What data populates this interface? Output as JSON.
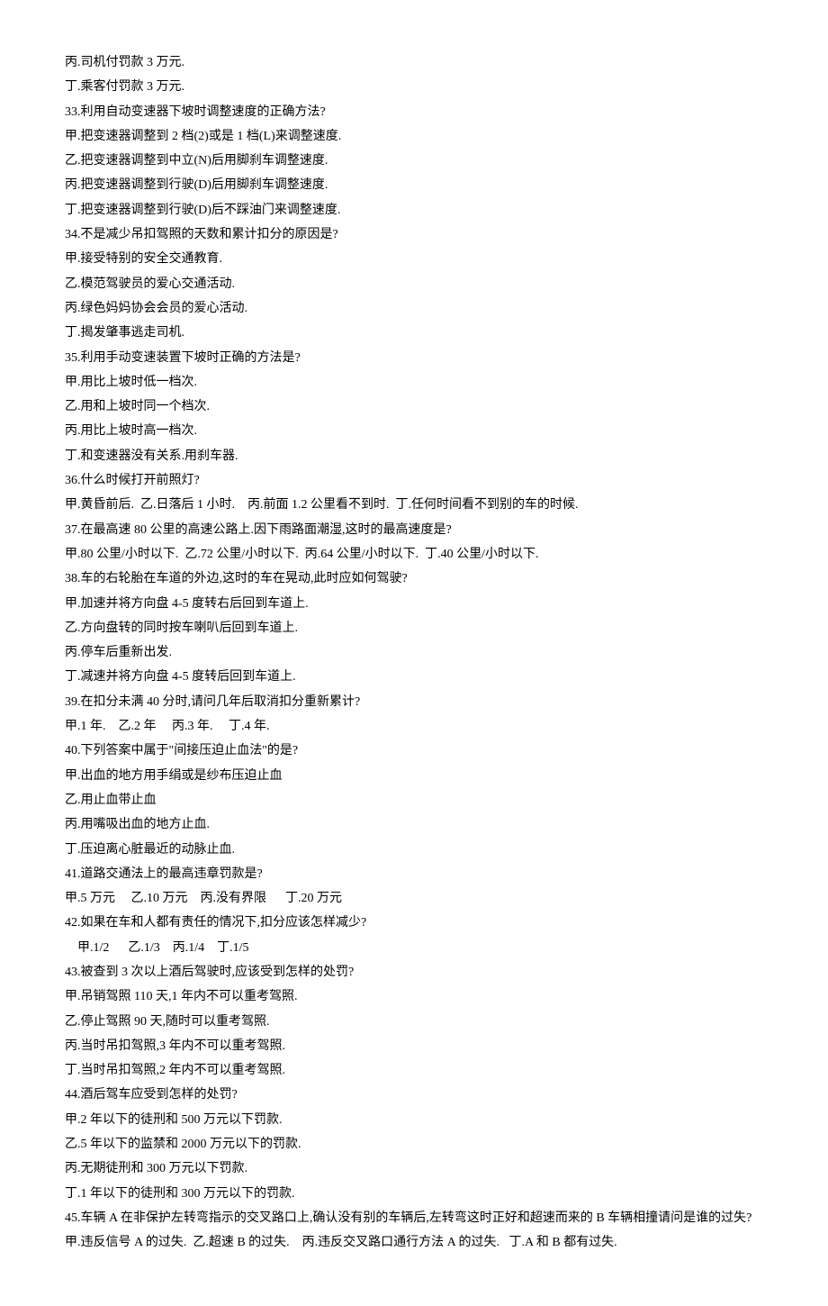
{
  "lines": [
    {
      "text": "丙.司机付罚款 3 万元.",
      "indent": false
    },
    {
      "text": "丁.乘客付罚款 3 万元.",
      "indent": false
    },
    {
      "text": "33.利用自动变速器下坡时调整速度的正确方法?",
      "indent": false
    },
    {
      "text": "甲.把变速器调整到 2 档(2)或是 1 档(L)来调整速度.",
      "indent": false
    },
    {
      "text": "乙.把变速器调整到中立(N)后用脚刹车调整速度.",
      "indent": false
    },
    {
      "text": "丙.把变速器调整到行驶(D)后用脚刹车调整速度.",
      "indent": false
    },
    {
      "text": "丁.把变速器调整到行驶(D)后不踩油门来调整速度.",
      "indent": false
    },
    {
      "text": "34.不是减少吊扣驾照的天数和累计扣分的原因是?",
      "indent": false
    },
    {
      "text": "甲.接受特别的安全交通教育.",
      "indent": false
    },
    {
      "text": "乙.模范驾驶员的爱心交通活动.",
      "indent": false
    },
    {
      "text": "丙.绿色妈妈协会会员的爱心活动.",
      "indent": false
    },
    {
      "text": "丁.揭发肇事逃走司机.",
      "indent": false
    },
    {
      "text": "35.利用手动变速装置下坡时正确的方法是?",
      "indent": false
    },
    {
      "text": "甲.用比上坡时低一档次.",
      "indent": false
    },
    {
      "text": "乙.用和上坡时同一个档次.",
      "indent": false
    },
    {
      "text": "丙.用比上坡时高一档次.",
      "indent": false
    },
    {
      "text": "丁.和变速器没有关系.用刹车器.",
      "indent": false
    },
    {
      "text": "36.什么时候打开前照灯?",
      "indent": false
    },
    {
      "text": "甲.黄昏前后.  乙.日落后 1 小时.    丙.前面 1.2 公里看不到时.  丁.任何时间看不到别的车的时候.",
      "indent": false
    },
    {
      "text": "37.在最高速 80 公里的高速公路上.因下雨路面潮湿,这时的最高速度是?",
      "indent": false
    },
    {
      "text": "甲.80 公里/小时以下.  乙.72 公里/小时以下.  丙.64 公里/小时以下.  丁.40 公里/小时以下.",
      "indent": false
    },
    {
      "text": "38.车的右轮胎在车道的外边,这时的车在晃动,此时应如何驾驶?",
      "indent": false
    },
    {
      "text": "甲.加速并将方向盘 4-5 度转右后回到车道上.",
      "indent": false
    },
    {
      "text": "乙.方向盘转的同时按车喇叭后回到车道上.",
      "indent": false
    },
    {
      "text": "丙.停车后重新出发.",
      "indent": false
    },
    {
      "text": "丁.减速并将方向盘 4-5 度转后回到车道上.",
      "indent": false
    },
    {
      "text": "39.在扣分未满 40 分时,请问几年后取消扣分重新累计?",
      "indent": false
    },
    {
      "text": "甲.1 年.    乙.2 年     丙.3 年.     丁.4 年.",
      "indent": false
    },
    {
      "text": "40.下列答案中属于\"间接压迫止血法\"的是?",
      "indent": false
    },
    {
      "text": "甲.出血的地方用手绢或是纱布压迫止血",
      "indent": false
    },
    {
      "text": "乙.用止血带止血",
      "indent": false
    },
    {
      "text": "丙.用嘴吸出血的地方止血.",
      "indent": false
    },
    {
      "text": "丁.压迫离心脏最近的动脉止血.",
      "indent": false
    },
    {
      "text": "41.道路交通法上的最高违章罚款是?",
      "indent": false
    },
    {
      "text": "甲.5 万元     乙.10 万元    丙.没有界限      丁.20 万元",
      "indent": false
    },
    {
      "text": "42.如果在车和人都有责任的情况下,扣分应该怎样减少?",
      "indent": false
    },
    {
      "text": "甲.1/2      乙.1/3    丙.1/4    丁.1/5",
      "indent": true
    },
    {
      "text": "43.被查到 3 次以上酒后驾驶时,应该受到怎样的处罚?",
      "indent": false
    },
    {
      "text": "甲.吊销驾照 110 天,1 年内不可以重考驾照.",
      "indent": false
    },
    {
      "text": "乙.停止驾照 90 天,随时可以重考驾照.",
      "indent": false
    },
    {
      "text": "丙.当时吊扣驾照,3 年内不可以重考驾照.",
      "indent": false
    },
    {
      "text": "丁.当时吊扣驾照,2 年内不可以重考驾照.",
      "indent": false
    },
    {
      "text": "44.酒后驾车应受到怎样的处罚?",
      "indent": false
    },
    {
      "text": "甲.2 年以下的徒刑和 500 万元以下罚款.",
      "indent": false
    },
    {
      "text": "乙.5 年以下的监禁和 2000 万元以下的罚款.",
      "indent": false
    },
    {
      "text": "丙.无期徒刑和 300 万元以下罚款.",
      "indent": false
    },
    {
      "text": "丁.1 年以下的徒刑和 300 万元以下的罚款.",
      "indent": false
    },
    {
      "text": "45.车辆 A 在非保护左转弯指示的交叉路口上,确认没有别的车辆后,左转弯这时正好和超速而来的 B 车辆相撞请问是谁的过失?",
      "indent": false
    },
    {
      "text": "甲.违反信号 A 的过失.  乙.超速 B 的过失.    丙.违反交叉路口通行方法 A 的过失.   丁.A 和 B 都有过失.",
      "indent": false
    }
  ]
}
